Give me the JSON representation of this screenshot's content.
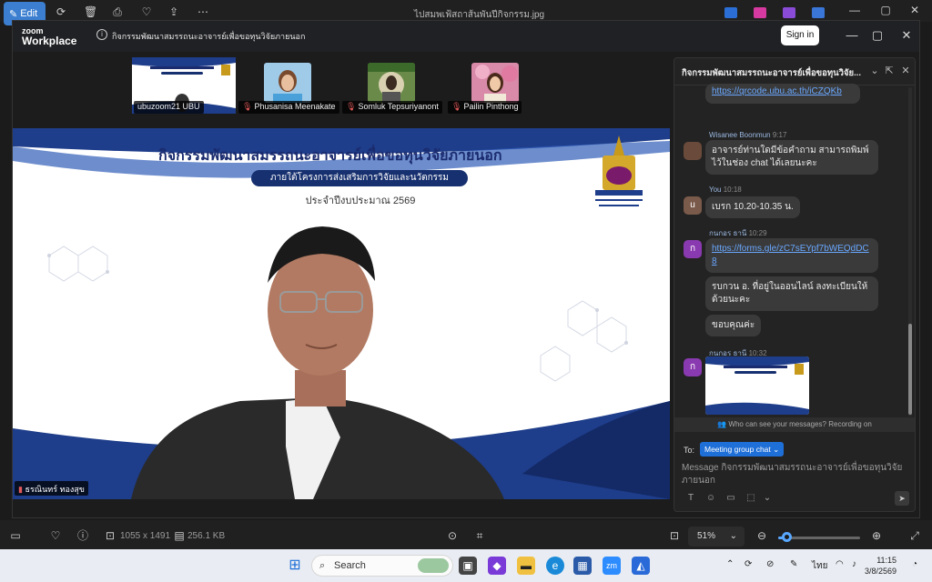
{
  "viewer": {
    "edit_label": "Edit",
    "file_title": "ไปสมพเฟ้สถาส้นพันปีกิจกรรม.jpg",
    "dimensions": "1055 x 1491",
    "file_size": "256.1 KB",
    "zoom_level": "51%",
    "zoom_slider_value": 0.1
  },
  "zoom_app": {
    "logo_top": "zoom",
    "logo_bottom": "Workplace",
    "meeting_title": "กิจกรรมพัฒนาสมรรถนะอาจารย์เพื่อขอทุนวิจัยภายนอก",
    "signin_label": "Sign in"
  },
  "participants": [
    {
      "name": "ubuzoom21 UBU",
      "muted": false
    },
    {
      "name": "Phusanisa Meenakate",
      "muted": true
    },
    {
      "name": "Somluk Tepsuriyanont",
      "muted": true
    },
    {
      "name": "Pailin Pinthong",
      "muted": true
    }
  ],
  "slide": {
    "title": "กิจกรรมพัฒนาสมรรถนะอาจารย์เพื่อขอทุนวิจัยภายนอก",
    "subtitle": "ภายใต้โครงการส่งเสริมการวิจัยและนวัตกรรม",
    "year": "ประจำปีงบประมาณ 2569",
    "speaker": "ธรณินทร์ ทองสุข"
  },
  "chat": {
    "title": "กิจกรรมพัฒนาสมรรถนะอาจารย์เพื่อขอทุนวิจัย...",
    "messages": {
      "m0_link": "https://qrcode.ubu.ac.th/iCZQKb",
      "m1_sender": "Wisanee Boonmun",
      "m1_time": "9:17",
      "m1_text": "อาจารย์ท่านใดมีข้อคำถาม สามารถพิมพ์ไว้ในช่อง chat ได้เลยนะคะ",
      "m2_sender": "You",
      "m2_time": "10:18",
      "m2_avatar": "u",
      "m2_text": "เบรก 10.20-10.35 น.",
      "m3_sender": "กนกอร ธานี",
      "m3_time": "10:29",
      "m3_avatar": "ก",
      "m3_link": "https://forms.gle/zC7sEYpf7bWEQdDC8",
      "m3_text2": "รบกวน อ. ที่อยู่ในออนไลน์ ลงทะเบียนให้ด้วยนะคะ",
      "m3_text3": "ขอบคุณค่ะ",
      "m4_sender": "กนกอร ธานี",
      "m4_time": "10:32",
      "m4_avatar": "ก"
    },
    "privacy_text": "Who can see your messages? Recording on",
    "to_label": "To:",
    "to_value": "Meeting group chat",
    "input_placeholder": "Message กิจกรรมพัฒนาสมรรถนะอาจารย์เพื่อขอทุนวิจัยภายนอก"
  },
  "taskbar": {
    "search_placeholder": "Search",
    "language": "ไทย",
    "time": "11:15",
    "date": "3/8/2569"
  },
  "colors": {
    "accent": "#1f6fd8",
    "slide_navy": "#17306f",
    "link": "#6aa8ff"
  }
}
